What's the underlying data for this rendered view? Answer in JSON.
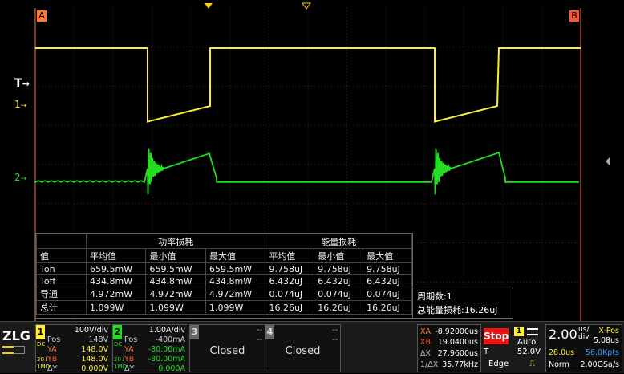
{
  "markers": {
    "a": "A",
    "b": "B",
    "trigger": "T",
    "ch1": "1",
    "ch2": "2"
  },
  "measure": {
    "power_header": "功率损耗",
    "energy_header": "能量损耗",
    "col_name": "值",
    "cols": [
      "平均值",
      "最小值",
      "最大值",
      "平均值",
      "最小值",
      "最大值"
    ],
    "rows": [
      {
        "name": "Ton",
        "vals": [
          "659.5mW",
          "659.5mW",
          "659.5mW",
          "9.758uJ",
          "9.758uJ",
          "9.758uJ"
        ]
      },
      {
        "name": "Toff",
        "vals": [
          "434.8mW",
          "434.8mW",
          "434.8mW",
          "6.432uJ",
          "6.432uJ",
          "6.432uJ"
        ]
      },
      {
        "name": "导通",
        "vals": [
          "4.972mW",
          "4.972mW",
          "4.972mW",
          "0.074uJ",
          "0.074uJ",
          "0.074uJ"
        ]
      },
      {
        "name": "总计",
        "vals": [
          "1.099W",
          "1.099W",
          "1.099W",
          "16.26uJ",
          "16.26uJ",
          "16.26uJ"
        ]
      }
    ]
  },
  "period": {
    "count_label": "周期数:1",
    "total_label": "总能量损耗:16.26uJ"
  },
  "brand": "ZLG",
  "ch1": {
    "num": "1",
    "scale": "100V/div",
    "pos_label": "Pos",
    "pos": "148V",
    "ya_label": "YA",
    "ya": "148.0V",
    "yb_label": "YB",
    "yb": "148.0V",
    "dy_label": "ΔY",
    "dy": "0.000V",
    "cpl1": "DC",
    "cpl2": "1MΩ",
    "cpl3": "20↓"
  },
  "ch2": {
    "num": "2",
    "scale": "1.00A/div",
    "pos_label": "Pos",
    "pos": "-400mA",
    "ya_label": "YA",
    "ya": "-80.00mA",
    "yb_label": "YB",
    "yb": "-80.00mA",
    "dy_label": "ΔY",
    "dy": "0.000A",
    "cpl1": "DC",
    "cpl2": "1MΩ",
    "cpl3": "20↓"
  },
  "ch3": {
    "num": "3",
    "top": "--",
    "top2": "--",
    "status": "Closed"
  },
  "ch4": {
    "num": "4",
    "top": "--",
    "top2": "--",
    "status": "Closed"
  },
  "cursor": {
    "xa_label": "XA",
    "xa": "-8.92000us",
    "xb_label": "XB",
    "xb": "19.0400us",
    "dx_label": "ΔX",
    "dx": "27.9600us",
    "inv_label": "1/ΔX",
    "inv": "35.77kHz"
  },
  "acq": {
    "stop": "Stop",
    "trig_ch": "1",
    "mode": "Auto",
    "t_label": "T",
    "t_val": "52.0V",
    "edge": "Edge"
  },
  "timebase": {
    "value": "2.00",
    "unit_top": "us/",
    "unit_bot": "div",
    "xpos_label": "X-Pos",
    "xpos": "5.08us",
    "delay": "28.0us",
    "pts": "56.0Kpts",
    "norm": "Norm",
    "rate": "2.00GSa/s"
  },
  "colors": {
    "ch1": "#ffee33",
    "ch2": "#22dd22",
    "marker": "#ff7733",
    "stop": "#ee1111",
    "grid": "#333333"
  }
}
